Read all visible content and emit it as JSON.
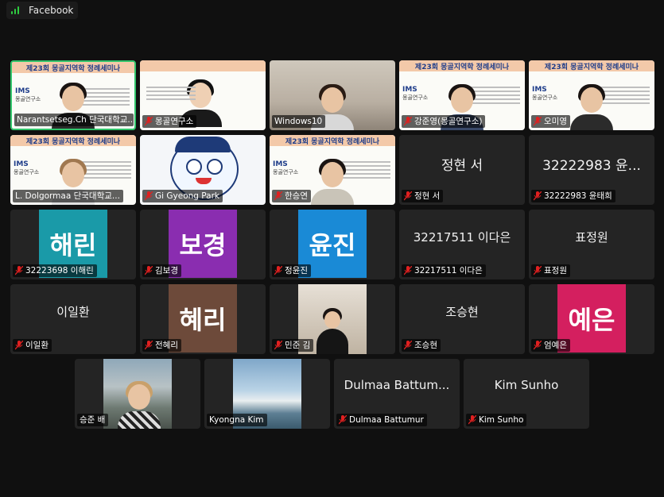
{
  "app": {
    "title": "Facebook",
    "signal_icon": "signal-icon"
  },
  "colors": {
    "active_border": "#31c56b",
    "mic_muted": "#e02020"
  },
  "slide_title": "제23회 몽골지역학 정례세미나",
  "slide_logo": "IMS",
  "slide_logo_sub": "몽골연구소",
  "participants": [
    {
      "name": "Narantsetseg.Ch 단국대학교...",
      "muted": false,
      "active": true
    },
    {
      "name": "몽골연구소",
      "muted": true
    },
    {
      "name": "Windows10",
      "muted": false
    },
    {
      "name": "강준영(몽골연구소)",
      "muted": true
    },
    {
      "name": "오미영",
      "muted": true
    },
    {
      "name": "L. Dolgormaa 단국대학교...",
      "muted": false
    },
    {
      "name": "Gi Gyeong Park",
      "muted": true
    },
    {
      "name": "한승연",
      "muted": true
    },
    {
      "name": "정현 서",
      "muted": true,
      "display": "정현 서"
    },
    {
      "name": "32222983 윤태희",
      "muted": true,
      "display": "32222983 윤..."
    },
    {
      "name": "32223698 이해린",
      "muted": true,
      "avatar": "해린",
      "avatar_color": "#1a9aa8"
    },
    {
      "name": "김보경",
      "muted": true,
      "avatar": "보경",
      "avatar_color": "#8a2db0"
    },
    {
      "name": "정윤진",
      "muted": true,
      "avatar": "윤진",
      "avatar_color": "#1a8ad6"
    },
    {
      "name": "32217511 이다은",
      "muted": true,
      "display": "32217511 이다은"
    },
    {
      "name": "표정원",
      "muted": true,
      "display": "표정원"
    },
    {
      "name": "이일환",
      "muted": true,
      "display": "이일환"
    },
    {
      "name": "전혜리",
      "muted": true,
      "avatar": "혜리",
      "avatar_color": "#6d4a3a"
    },
    {
      "name": "민준 김",
      "muted": true
    },
    {
      "name": "조승현",
      "muted": true,
      "display": "조승현"
    },
    {
      "name": "엄예은",
      "muted": true,
      "avatar": "예은",
      "avatar_color": "#d41f5f"
    },
    {
      "name": "승준 배",
      "muted": false
    },
    {
      "name": "Kyongna Kim",
      "muted": false
    },
    {
      "name": "Dulmaa Battumur",
      "muted": true,
      "display": "Dulmaa Battum..."
    },
    {
      "name": "Kim Sunho",
      "muted": true,
      "display": "Kim Sunho"
    }
  ]
}
